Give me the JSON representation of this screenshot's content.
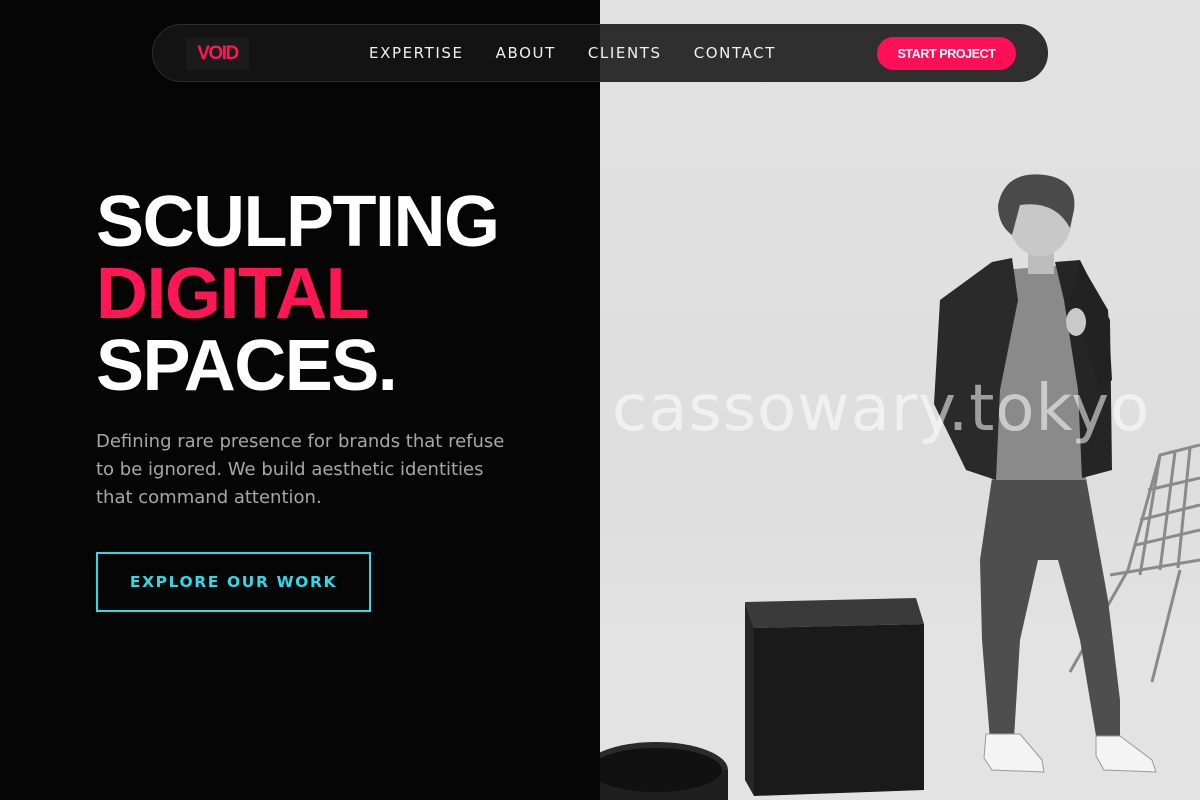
{
  "brand": {
    "logo_text": "VOID",
    "accent_color": "#ff1654",
    "secondary_color": "#2ed9e8"
  },
  "nav": {
    "links": [
      "EXPERTISE",
      "ABOUT",
      "CLIENTS",
      "CONTACT"
    ],
    "cta_label": "START PROJECT"
  },
  "hero": {
    "headline_line1": "SCULPTING",
    "headline_line2": "DIGITAL",
    "headline_line3": "SPACES.",
    "subtitle": "Defining rare presence for brands that refuse to be ignored. We build aesthetic identities that command attention.",
    "button_label": "EXPLORE OUR WORK"
  },
  "photo": {
    "watermark_text": "cassowary.tokyo"
  }
}
